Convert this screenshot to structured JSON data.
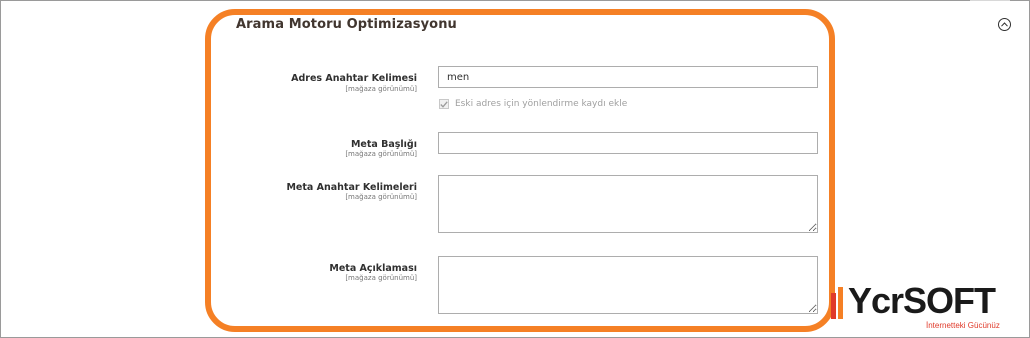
{
  "section": {
    "title": "Arama Motoru Optimizasyonu",
    "collapse_icon": "collapse-up-icon"
  },
  "fields": {
    "url_key": {
      "label": "Adres Anahtar Kelimesi",
      "scope": "[mağaza görünümü]",
      "value": "men"
    },
    "redirect": {
      "label": "Eski adres için yönlendirme kaydı ekle",
      "checked": true
    },
    "meta_title": {
      "label": "Meta Başlığı",
      "scope": "[mağaza görünümü]",
      "value": ""
    },
    "meta_keywords": {
      "label": "Meta Anahtar Kelimeleri",
      "scope": "[mağaza görünümü]",
      "value": ""
    },
    "meta_description": {
      "label": "Meta Açıklaması",
      "scope": "[mağaza görünümü]",
      "value": ""
    }
  },
  "watermark": {
    "brand": "YcrSOFT",
    "tagline": "İnternetteki Gücünüz"
  },
  "colors": {
    "highlight": "#f58025",
    "logo_red": "#e03a2a",
    "logo_orange": "#f58025"
  }
}
